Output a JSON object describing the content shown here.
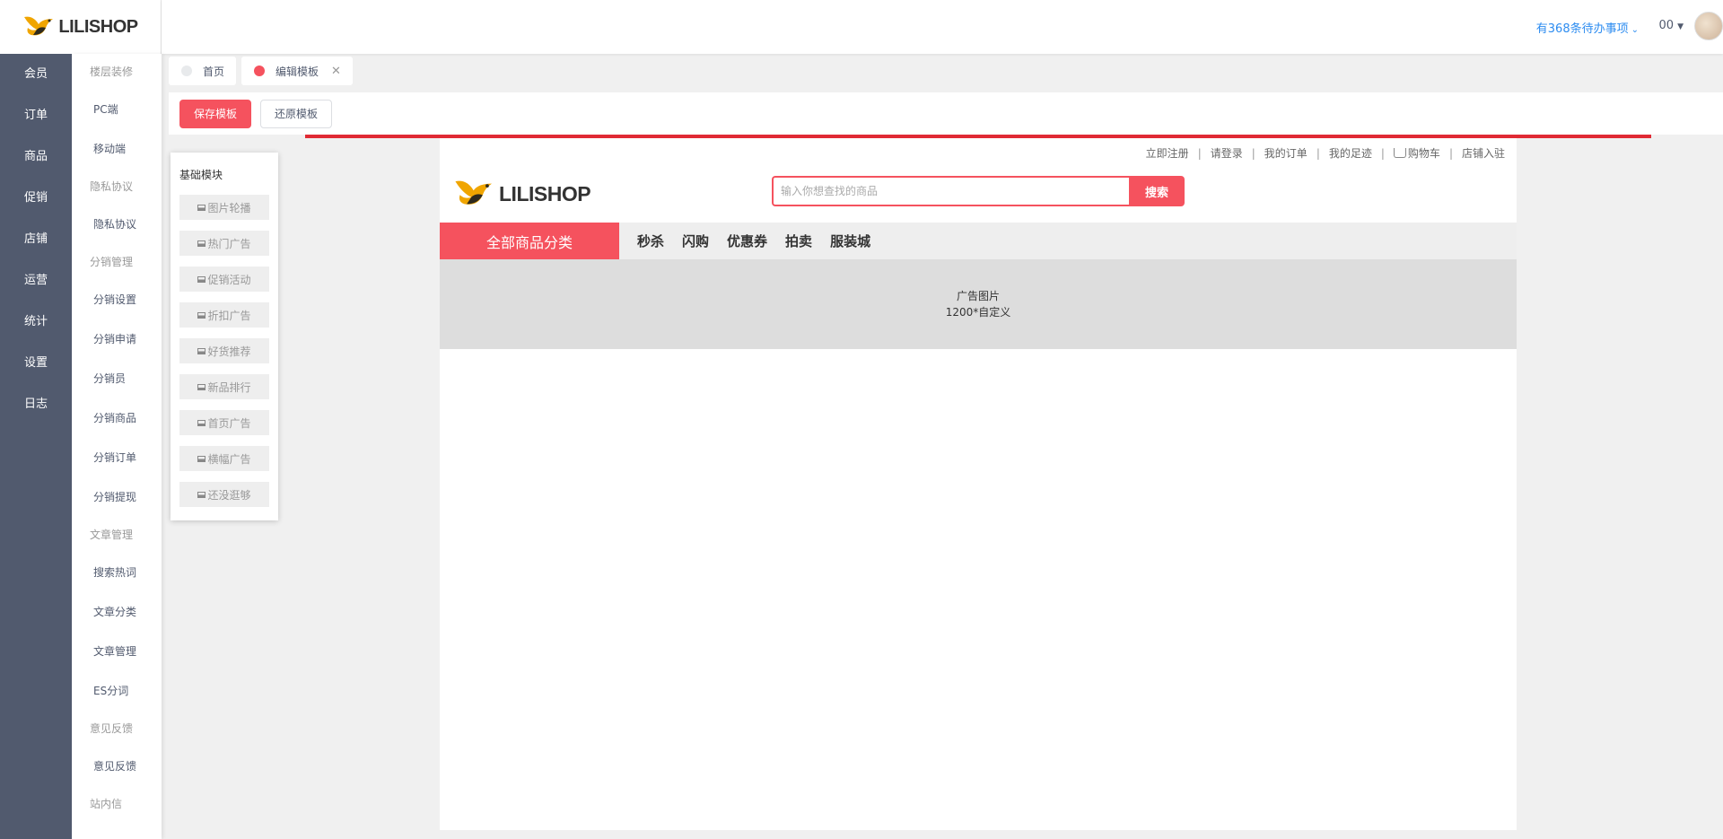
{
  "app": {
    "logo_text": "LILISHOP"
  },
  "header": {
    "todo_label": "有368条待办事项",
    "user_name": "00"
  },
  "primary_nav": [
    "会员",
    "订单",
    "商品",
    "促销",
    "店铺",
    "运营",
    "统计",
    "设置",
    "日志"
  ],
  "secondary_nav": {
    "group_floor": "楼层装修",
    "item_pc": "PC端",
    "item_mobile": "移动端",
    "group_privacy": "隐私协议",
    "item_privacy": "隐私协议",
    "group_distribution": "分销管理",
    "item_dist_settings": "分销设置",
    "item_dist_apply": "分销申请",
    "item_dist_member": "分销员",
    "item_dist_goods": "分销商品",
    "item_dist_order": "分销订单",
    "item_dist_withdraw": "分销提现",
    "group_article": "文章管理",
    "item_hot_words": "搜索热词",
    "item_article_category": "文章分类",
    "item_article_manage": "文章管理",
    "item_es": "ES分词",
    "group_feedback": "意见反馈",
    "item_feedback": "意见反馈",
    "group_message": "站内信"
  },
  "tabs": [
    {
      "label": "首页",
      "dot_color": "#e8eaec"
    },
    {
      "label": "编辑模板",
      "dot_color": "#f5525e"
    }
  ],
  "toolbar": {
    "save_label": "保存模板",
    "restore_label": "还原模板"
  },
  "modules": {
    "title": "基础模块",
    "items": [
      "图片轮播",
      "热门广告",
      "促销活动",
      "折扣广告",
      "好货推荐",
      "新品排行",
      "首页广告",
      "横幅广告",
      "还没逛够"
    ]
  },
  "preview": {
    "top_links": {
      "register": "立即注册",
      "login": "请登录",
      "orders": "我的订单",
      "footprint": "我的足迹",
      "cart": "购物车",
      "store_join": "店铺入驻"
    },
    "search_placeholder": "输入你想查找的商品",
    "search_button": "搜索",
    "category_all": "全部商品分类",
    "nav_links": [
      "秒杀",
      "闪购",
      "优惠券",
      "拍卖",
      "服装城"
    ],
    "ad_line1": "广告图片",
    "ad_line2": "1200*自定义"
  },
  "colors": {
    "accent": "#f5525e",
    "nav_dark": "#515a6e",
    "link_blue": "#2d8cf0"
  }
}
